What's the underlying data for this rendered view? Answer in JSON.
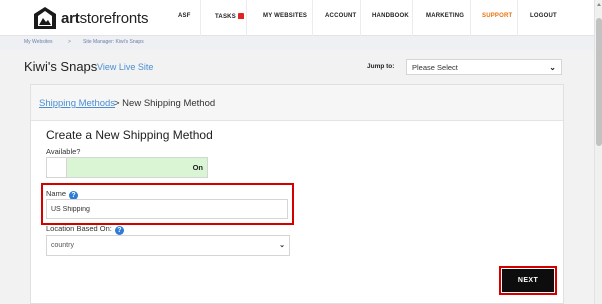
{
  "brand": {
    "name_bold": "art",
    "name_rest": "storefronts"
  },
  "nav": {
    "items": [
      {
        "label": "ASF"
      },
      {
        "label": "TASKS"
      },
      {
        "label": "MY WEBSITES"
      },
      {
        "label": "ACCOUNT"
      },
      {
        "label": "HANDBOOK"
      },
      {
        "label": "MARKETING"
      },
      {
        "label": "SUPPORT"
      },
      {
        "label": "LOGOUT"
      }
    ],
    "active_color": "#e8720c"
  },
  "breadcrumb": {
    "items": [
      "My Websites",
      "Site Manager: Kiwi's Snaps"
    ],
    "separator": ">"
  },
  "header": {
    "title": "Kiwi's Snaps",
    "view_live": "View Live Site",
    "jump_label": "Jump to:",
    "jump_value": "Please Select"
  },
  "card": {
    "crumb_link": "Shipping Methods",
    "crumb_rest": "> New Shipping Method"
  },
  "form": {
    "title": "Create a New Shipping Method",
    "available_label": "Available?",
    "available_state": "On",
    "name_label": "Name",
    "name_value": "US Shipping",
    "location_label": "Location Based On:",
    "location_value": "country",
    "next_label": "NEXT"
  },
  "icons": {
    "help": "question-circle-icon",
    "bell": "bell-icon",
    "chevron": "chevron-down-icon",
    "logo": "frame-logo-icon"
  },
  "colors": {
    "link": "#4a8fd4",
    "highlight": "#d40000",
    "toggle_on": "#d9f5d4",
    "button": "#0d0d0d"
  }
}
